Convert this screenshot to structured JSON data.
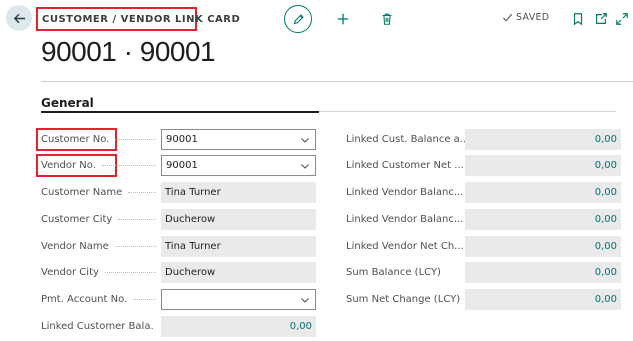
{
  "header": {
    "caption": "CUSTOMER / VENDOR LINK CARD",
    "saved_label": "SAVED"
  },
  "title": "90001 · 90001",
  "section": {
    "title": "General"
  },
  "left_fields": [
    {
      "label": "Customer No.",
      "value": "90001"
    },
    {
      "label": "Vendor No.",
      "value": "90001"
    },
    {
      "label": "Customer Name",
      "value": "Tina Turner"
    },
    {
      "label": "Customer City",
      "value": "Ducherow"
    },
    {
      "label": "Vendor Name",
      "value": "Tina Turner"
    },
    {
      "label": "Vendor City",
      "value": "Ducherow"
    },
    {
      "label": "Pmt. Account No.",
      "value": ""
    },
    {
      "label": "Linked Customer Bala...",
      "value": "0,00"
    }
  ],
  "right_fields": [
    {
      "label": "Linked Cust. Balance a...",
      "value": "0,00"
    },
    {
      "label": "Linked Customer Net ...",
      "value": "0,00"
    },
    {
      "label": "Linked Vendor Balanc...",
      "value": "0,00"
    },
    {
      "label": "Linked Vendor Balanc...",
      "value": "0,00"
    },
    {
      "label": "Linked Vendor Net Ch...",
      "value": "0,00"
    },
    {
      "label": "Sum Balance (LCY)",
      "value": "0,00"
    },
    {
      "label": "Sum Net Change (LCY)",
      "value": "0,00"
    }
  ],
  "colors": {
    "accent": "#00796b",
    "highlight": "#e0232c",
    "readonly_bg": "#eaeaea",
    "number": "#00707a"
  },
  "icons": [
    "back-arrow-icon",
    "pencil-icon",
    "plus-icon",
    "trash-icon",
    "checkmark-icon",
    "bookmark-icon",
    "open-new-window-icon",
    "expand-icon",
    "chevron-down-icon"
  ]
}
